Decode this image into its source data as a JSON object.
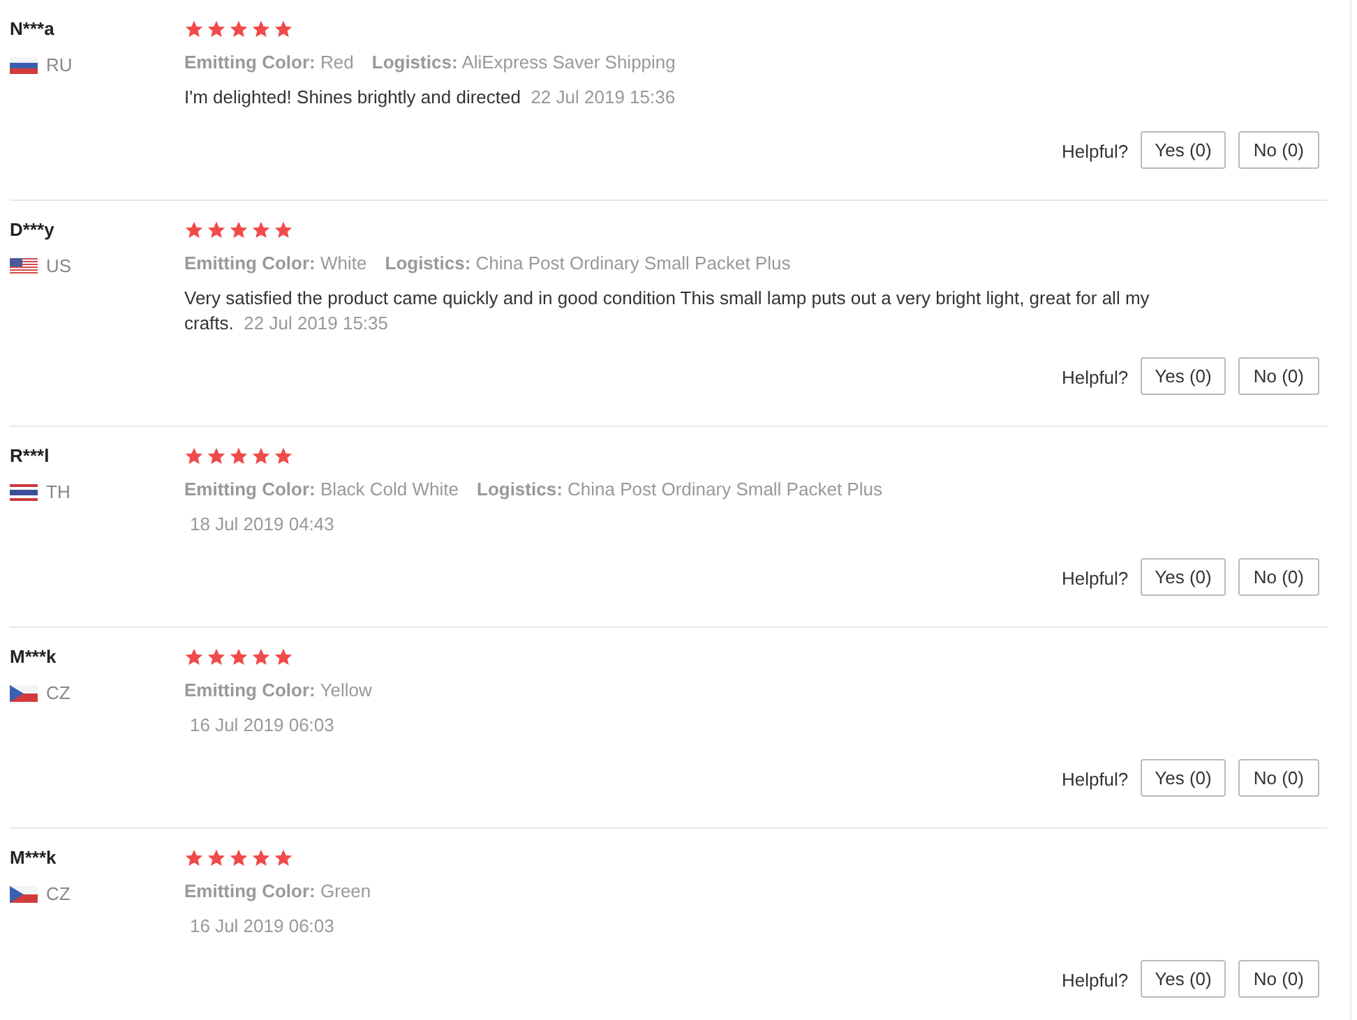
{
  "reviews": [
    {
      "name": "N***a",
      "flag": {
        "kind": "russia"
      },
      "country": "RU",
      "stars": 5,
      "attributes": [
        {
          "label": "Emitting Color:",
          "value": "Red"
        },
        {
          "label": "Logistics:",
          "value": "AliExpress Saver Shipping"
        }
      ],
      "comment": "I'm delighted! Shines brightly and directed",
      "date": "22 Jul 2019 15:36",
      "helpful_label": "Helpful?",
      "yes": "Yes (0)",
      "no": "No (0)"
    },
    {
      "name": "D***y",
      "flag": {
        "kind": "usa"
      },
      "country": "US",
      "stars": 5,
      "attributes": [
        {
          "label": "Emitting Color:",
          "value": "White"
        },
        {
          "label": "Logistics:",
          "value": "China Post Ordinary Small Packet Plus"
        }
      ],
      "comment": "Very satisfied the product came quickly and in good condition This small lamp puts out a very bright light, great for all my crafts.",
      "date": "22 Jul 2019 15:35",
      "helpful_label": "Helpful?",
      "yes": "Yes (0)",
      "no": "No (0)"
    },
    {
      "name": "R***l",
      "flag": {
        "kind": "thailand"
      },
      "country": "TH",
      "stars": 5,
      "attributes": [
        {
          "label": "Emitting Color:",
          "value": "Black Cold White"
        },
        {
          "label": "Logistics:",
          "value": "China Post Ordinary Small Packet Plus"
        }
      ],
      "date": "18 Jul 2019 04:43",
      "helpful_label": "Helpful?",
      "yes": "Yes (0)",
      "no": "No (0)"
    },
    {
      "name": "M***k",
      "flag": {
        "kind": "czechia"
      },
      "country": "CZ",
      "stars": 5,
      "attributes": [
        {
          "label": "Emitting Color:",
          "value": "Yellow"
        }
      ],
      "date": "16 Jul 2019 06:03",
      "helpful_label": "Helpful?",
      "yes": "Yes (0)",
      "no": "No (0)"
    },
    {
      "name": "M***k",
      "flag": {
        "kind": "czechia"
      },
      "country": "CZ",
      "stars": 5,
      "attributes": [
        {
          "label": "Emitting Color:",
          "value": "Green"
        }
      ],
      "date": "16 Jul 2019 06:03",
      "helpful_label": "Helpful?",
      "yes": "Yes (0)",
      "no": "No (0)"
    }
  ]
}
